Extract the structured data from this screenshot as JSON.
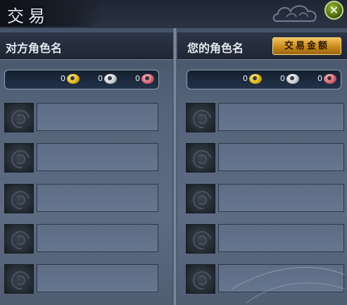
{
  "window": {
    "title": "交易",
    "close_label": "✕"
  },
  "left_panel": {
    "header": "对方角色名",
    "money": {
      "gold": "0",
      "silver": "0",
      "copper": "0"
    },
    "slots": 5
  },
  "right_panel": {
    "header": "您的角色名",
    "trade_money_button": "交易金额",
    "money": {
      "gold": "0",
      "silver": "0",
      "copper": "0"
    },
    "slots": 5
  },
  "colors": {
    "accent_gold": "#e1b418",
    "panel_bg": "#5e6b82",
    "header_bg": "#1f2633"
  },
  "icons": [
    "close-icon",
    "gold-coin-icon",
    "silver-coin-icon",
    "copper-coin-icon",
    "empty-slot-icon",
    "cloud-ornament-icon"
  ]
}
